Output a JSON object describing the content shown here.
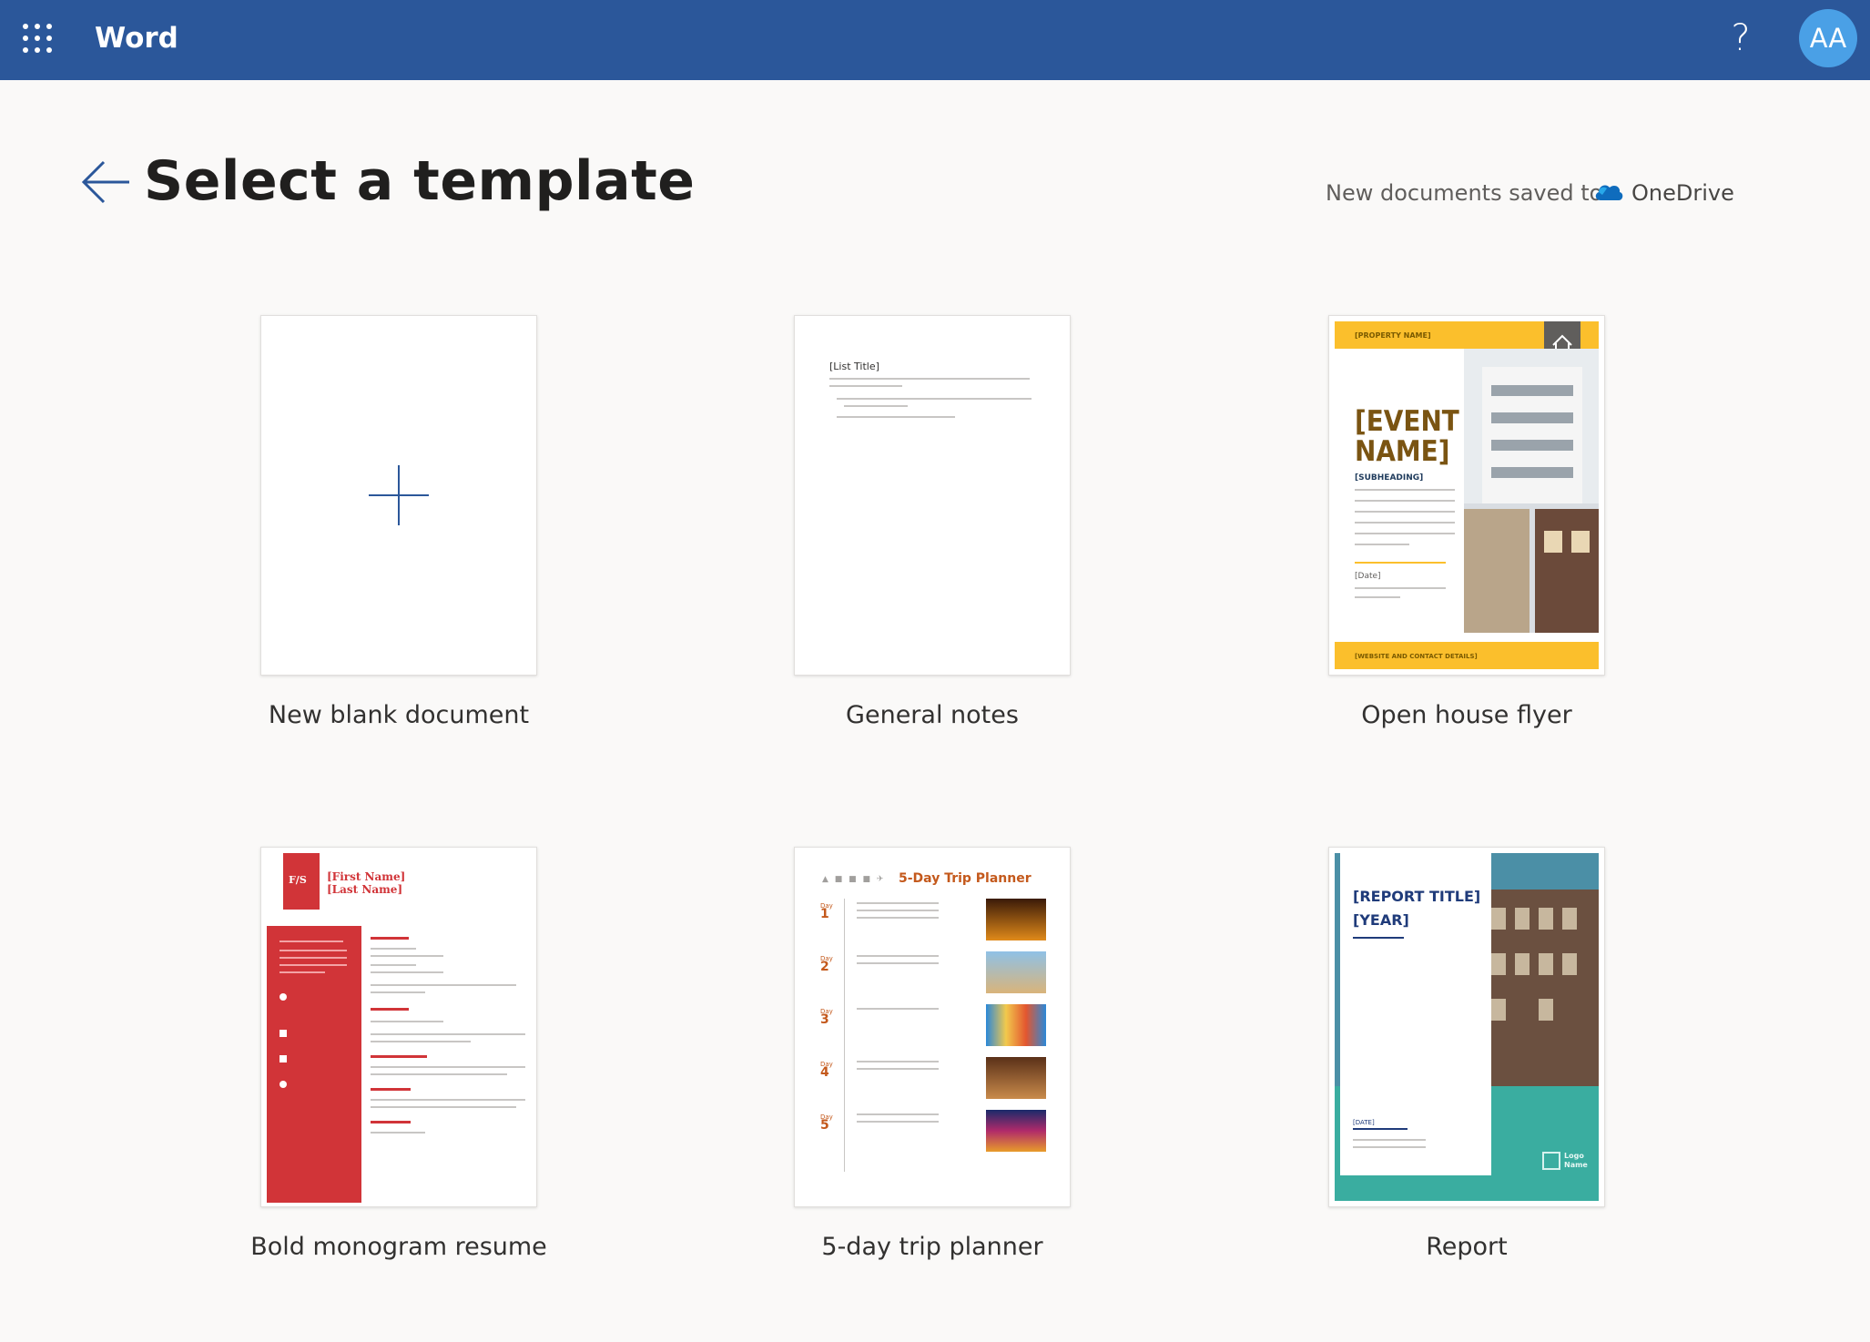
{
  "header": {
    "app_name": "Word",
    "help_label": "?",
    "avatar_initials": "AA",
    "bar_color": "#2b579a"
  },
  "page": {
    "title": "Select a template",
    "save_label": "New documents saved to:",
    "save_location": "OneDrive"
  },
  "templates": [
    {
      "label": "New blank document"
    },
    {
      "label": "General notes"
    },
    {
      "label": "Open house flyer"
    },
    {
      "label": "Bold monogram resume"
    },
    {
      "label": "5-day trip planner"
    },
    {
      "label": "Report"
    }
  ],
  "thumbnails": {
    "notes_title": "[List Title]",
    "flyer_property": "[PROPERTY NAME]",
    "flyer_event": "[EVENT NAME]",
    "flyer_subheading": "[SUBHEADING]",
    "flyer_date": "[Date]",
    "flyer_footer": "[WEBSITE AND CONTACT DETAILS]",
    "resume_monogram": "F/S",
    "resume_first": "[First Name]",
    "resume_last": "[Last Name]",
    "trip_title": "5-Day Trip Planner",
    "trip_days": [
      "1",
      "2",
      "3",
      "4",
      "5"
    ],
    "trip_day_label": "Day",
    "report_title": "[REPORT TITLE]",
    "report_year": "[YEAR]",
    "report_date": "[DATE]",
    "report_logo": "Logo Name"
  }
}
